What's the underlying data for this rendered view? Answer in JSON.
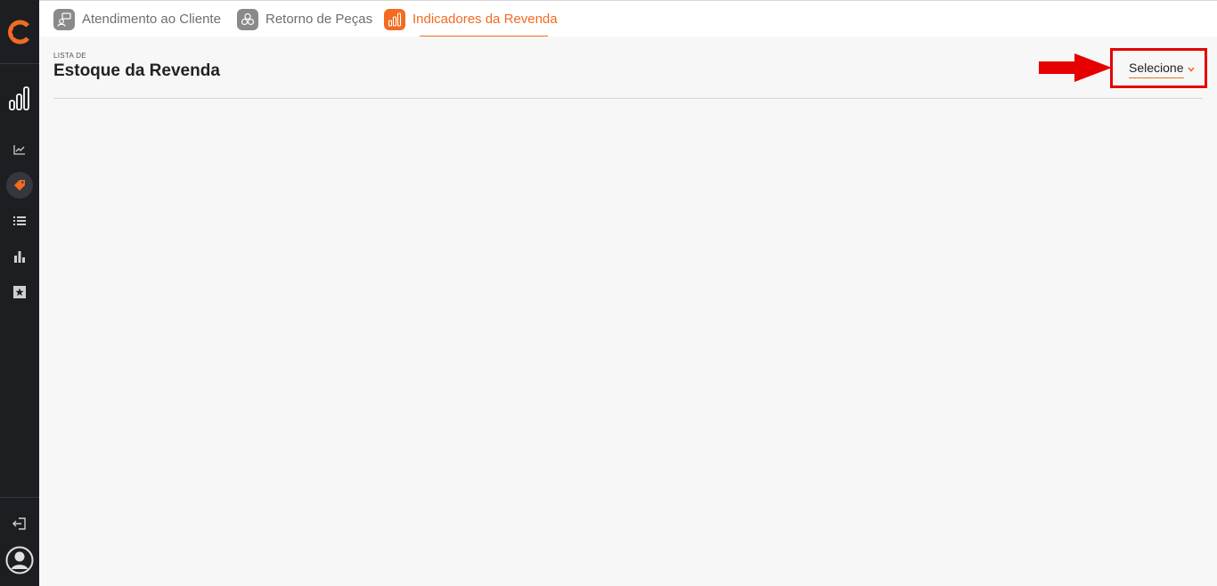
{
  "colors": {
    "accent": "#f26b21",
    "sidebar_bg": "#1c1e22",
    "highlight_red": "#e60000"
  },
  "sidebar": {
    "logo_icon": "brand-c-logo",
    "items": [
      {
        "icon": "line-chart-icon"
      },
      {
        "icon": "tag-icon",
        "active": true
      },
      {
        "icon": "list-icon"
      },
      {
        "icon": "bar-chart-icon"
      },
      {
        "icon": "star-box-icon"
      }
    ],
    "bottom": [
      {
        "icon": "logout-icon"
      },
      {
        "icon": "user-avatar-icon"
      }
    ]
  },
  "tabs": [
    {
      "label": "Atendimento ao Cliente",
      "icon": "customer-service-icon",
      "active": false
    },
    {
      "label": "Retorno de Peças",
      "icon": "parts-return-icon",
      "active": false
    },
    {
      "label": "Indicadores da Revenda",
      "icon": "bar-chart-icon",
      "active": true
    }
  ],
  "page": {
    "subtitle": "LISTA DE",
    "title": "Estoque da Revenda"
  },
  "select": {
    "label": "Selecione"
  }
}
